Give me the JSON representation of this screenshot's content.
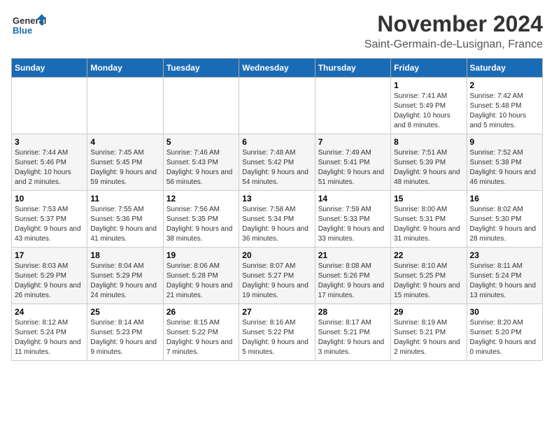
{
  "logo": {
    "text_general": "General",
    "text_blue": "Blue"
  },
  "header": {
    "month": "November 2024",
    "location": "Saint-Germain-de-Lusignan, France"
  },
  "weekdays": [
    "Sunday",
    "Monday",
    "Tuesday",
    "Wednesday",
    "Thursday",
    "Friday",
    "Saturday"
  ],
  "weeks": [
    [
      {
        "day": "",
        "info": ""
      },
      {
        "day": "",
        "info": ""
      },
      {
        "day": "",
        "info": ""
      },
      {
        "day": "",
        "info": ""
      },
      {
        "day": "",
        "info": ""
      },
      {
        "day": "1",
        "info": "Sunrise: 7:41 AM\nSunset: 5:49 PM\nDaylight: 10 hours and 8 minutes."
      },
      {
        "day": "2",
        "info": "Sunrise: 7:42 AM\nSunset: 5:48 PM\nDaylight: 10 hours and 5 minutes."
      }
    ],
    [
      {
        "day": "3",
        "info": "Sunrise: 7:44 AM\nSunset: 5:46 PM\nDaylight: 10 hours and 2 minutes."
      },
      {
        "day": "4",
        "info": "Sunrise: 7:45 AM\nSunset: 5:45 PM\nDaylight: 9 hours and 59 minutes."
      },
      {
        "day": "5",
        "info": "Sunrise: 7:46 AM\nSunset: 5:43 PM\nDaylight: 9 hours and 56 minutes."
      },
      {
        "day": "6",
        "info": "Sunrise: 7:48 AM\nSunset: 5:42 PM\nDaylight: 9 hours and 54 minutes."
      },
      {
        "day": "7",
        "info": "Sunrise: 7:49 AM\nSunset: 5:41 PM\nDaylight: 9 hours and 51 minutes."
      },
      {
        "day": "8",
        "info": "Sunrise: 7:51 AM\nSunset: 5:39 PM\nDaylight: 9 hours and 48 minutes."
      },
      {
        "day": "9",
        "info": "Sunrise: 7:52 AM\nSunset: 5:38 PM\nDaylight: 9 hours and 46 minutes."
      }
    ],
    [
      {
        "day": "10",
        "info": "Sunrise: 7:53 AM\nSunset: 5:37 PM\nDaylight: 9 hours and 43 minutes."
      },
      {
        "day": "11",
        "info": "Sunrise: 7:55 AM\nSunset: 5:36 PM\nDaylight: 9 hours and 41 minutes."
      },
      {
        "day": "12",
        "info": "Sunrise: 7:56 AM\nSunset: 5:35 PM\nDaylight: 9 hours and 38 minutes."
      },
      {
        "day": "13",
        "info": "Sunrise: 7:58 AM\nSunset: 5:34 PM\nDaylight: 9 hours and 36 minutes."
      },
      {
        "day": "14",
        "info": "Sunrise: 7:59 AM\nSunset: 5:33 PM\nDaylight: 9 hours and 33 minutes."
      },
      {
        "day": "15",
        "info": "Sunrise: 8:00 AM\nSunset: 5:31 PM\nDaylight: 9 hours and 31 minutes."
      },
      {
        "day": "16",
        "info": "Sunrise: 8:02 AM\nSunset: 5:30 PM\nDaylight: 9 hours and 28 minutes."
      }
    ],
    [
      {
        "day": "17",
        "info": "Sunrise: 8:03 AM\nSunset: 5:29 PM\nDaylight: 9 hours and 26 minutes."
      },
      {
        "day": "18",
        "info": "Sunrise: 8:04 AM\nSunset: 5:29 PM\nDaylight: 9 hours and 24 minutes."
      },
      {
        "day": "19",
        "info": "Sunrise: 8:06 AM\nSunset: 5:28 PM\nDaylight: 9 hours and 21 minutes."
      },
      {
        "day": "20",
        "info": "Sunrise: 8:07 AM\nSunset: 5:27 PM\nDaylight: 9 hours and 19 minutes."
      },
      {
        "day": "21",
        "info": "Sunrise: 8:08 AM\nSunset: 5:26 PM\nDaylight: 9 hours and 17 minutes."
      },
      {
        "day": "22",
        "info": "Sunrise: 8:10 AM\nSunset: 5:25 PM\nDaylight: 9 hours and 15 minutes."
      },
      {
        "day": "23",
        "info": "Sunrise: 8:11 AM\nSunset: 5:24 PM\nDaylight: 9 hours and 13 minutes."
      }
    ],
    [
      {
        "day": "24",
        "info": "Sunrise: 8:12 AM\nSunset: 5:24 PM\nDaylight: 9 hours and 11 minutes."
      },
      {
        "day": "25",
        "info": "Sunrise: 8:14 AM\nSunset: 5:23 PM\nDaylight: 9 hours and 9 minutes."
      },
      {
        "day": "26",
        "info": "Sunrise: 8:15 AM\nSunset: 5:22 PM\nDaylight: 9 hours and 7 minutes."
      },
      {
        "day": "27",
        "info": "Sunrise: 8:16 AM\nSunset: 5:22 PM\nDaylight: 9 hours and 5 minutes."
      },
      {
        "day": "28",
        "info": "Sunrise: 8:17 AM\nSunset: 5:21 PM\nDaylight: 9 hours and 3 minutes."
      },
      {
        "day": "29",
        "info": "Sunrise: 8:19 AM\nSunset: 5:21 PM\nDaylight: 9 hours and 2 minutes."
      },
      {
        "day": "30",
        "info": "Sunrise: 8:20 AM\nSunset: 5:20 PM\nDaylight: 9 hours and 0 minutes."
      }
    ]
  ]
}
